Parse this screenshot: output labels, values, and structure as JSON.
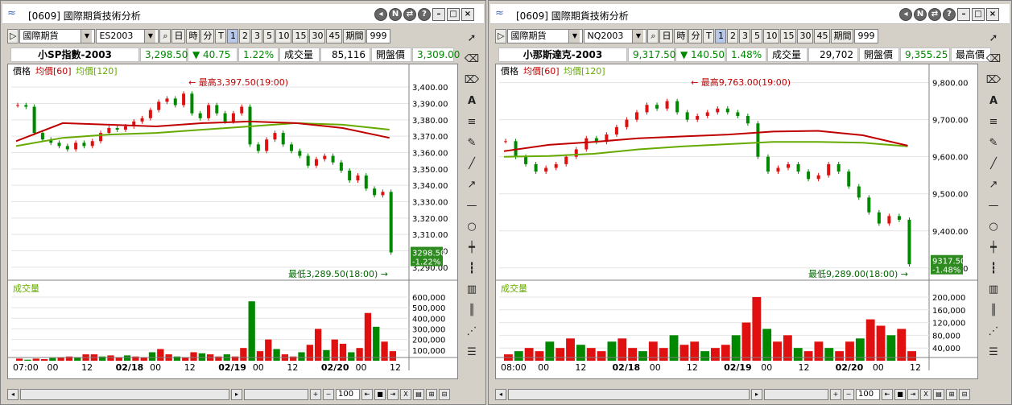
{
  "panels": [
    {
      "title": "[0609] 國際期貨技術分析",
      "market": "國際期貨",
      "code": "ES2003",
      "period_label": "期間",
      "period_value": "999",
      "name": "小SP指數-2003",
      "last": "3,298.50",
      "change": "40.75",
      "pct": "1.22%",
      "vol_label": "成交量",
      "vol": "85,116",
      "open_label": "開盤價",
      "open": "3,309.00",
      "legend_price": "價格",
      "legend_ma60": "均價[60]",
      "legend_ma120": "均價[120]",
      "high_note": "最高3,397.50(19:00)",
      "low_note": "最低3,289.50(18:00)",
      "tag_price": "3298.50",
      "tag_pct": "-1.22%",
      "vol_title": "成交量",
      "zoom": "100",
      "y_ticks": [
        "3,400.00",
        "3,390.00",
        "3,380.00",
        "3,370.00",
        "3,360.00",
        "3,350.00",
        "3,340.00",
        "3,330.00",
        "3,320.00",
        "3,310.00",
        "3,300.00",
        "3,290.00"
      ],
      "vol_ticks": [
        "600,000",
        "500,000",
        "400,000",
        "300,000",
        "200,000",
        "100,000"
      ],
      "x_labels": [
        "07:00",
        "00",
        "12",
        "02/18",
        "00",
        "12",
        "02/19",
        "00",
        "12",
        "02/20",
        "00",
        "12"
      ]
    },
    {
      "title": "[0609] 國際期貨技術分析",
      "market": "國際期貨",
      "code": "NQ2003",
      "period_label": "期間",
      "period_value": "999",
      "name": "小那斯達克-2003",
      "last": "9,317.50",
      "change": "140.50",
      "pct": "1.48%",
      "vol_label": "成交量",
      "vol": "29,702",
      "open_label": "開盤價",
      "open": "9,355.25",
      "high_label": "最高價",
      "legend_price": "價格",
      "legend_ma60": "均價[60]",
      "legend_ma120": "均價[120]",
      "high_note": "最高9,763.00(19:00)",
      "low_note": "最低9,289.00(18:00)",
      "tag_price": "9317.50",
      "tag_pct": "-1.48%",
      "vol_title": "成交量",
      "zoom": "100",
      "y_ticks": [
        "9,800.00",
        "9,700.00",
        "9,600.00",
        "9,500.00",
        "9,400.00",
        "9,300.00"
      ],
      "vol_ticks": [
        "200,000",
        "160,000",
        "120,000",
        "80,000",
        "40,000"
      ],
      "x_labels": [
        "08:00",
        "00",
        "12",
        "02/18",
        "00",
        "12",
        "02/19",
        "00",
        "12",
        "02/20",
        "00",
        "12"
      ]
    }
  ],
  "timeframes": [
    "日",
    "時",
    "分",
    "T",
    "1",
    "2",
    "3",
    "5",
    "10",
    "15",
    "30",
    "45"
  ],
  "colors": {
    "up": "#e01010",
    "down": "#008800",
    "ma60": "#c00000",
    "ma120": "#66aa00",
    "legend": "#c00000",
    "tag": "#2e8b20",
    "grid": "#e4e4e4"
  },
  "chart_data": [
    {
      "type": "candlestick",
      "title": "小SP指數-2003",
      "ylim": [
        3285,
        3405
      ],
      "y_values_approx": [
        3389,
        3388,
        3372,
        3368,
        3366,
        3364,
        3362,
        3366,
        3364,
        3367,
        3372,
        3375,
        3374,
        3376,
        3379,
        3381,
        3386,
        3391,
        3393,
        3389,
        3396,
        3384,
        3381,
        3389,
        3384,
        3379,
        3384,
        3388,
        3365,
        3361,
        3368,
        3372,
        3365,
        3361,
        3358,
        3352,
        3356,
        3358,
        3354,
        3349,
        3343,
        3346,
        3338,
        3334,
        3336,
        3299
      ],
      "ma60_approx": [
        3367,
        3378,
        3377,
        3376,
        3378,
        3379,
        3378,
        3375,
        3369
      ],
      "ma120_approx": [
        3364,
        3369,
        3371,
        3372,
        3374,
        3376,
        3378,
        3377,
        3374
      ],
      "volume_approx": [
        20000,
        10000,
        20000,
        15000,
        25000,
        30000,
        40000,
        30000,
        60000,
        60000,
        40000,
        50000,
        30000,
        50000,
        40000,
        30000,
        80000,
        110000,
        60000,
        40000,
        30000,
        80000,
        70000,
        60000,
        40000,
        60000,
        40000,
        120000,
        560000,
        90000,
        200000,
        110000,
        60000,
        40000,
        80000,
        150000,
        300000,
        100000,
        200000,
        160000,
        80000,
        120000,
        450000,
        320000,
        180000,
        90000
      ]
    },
    {
      "type": "candlestick",
      "title": "小那斯達克-2003",
      "ylim": [
        9280,
        9810
      ],
      "y_values_approx": [
        9642,
        9600,
        9580,
        9560,
        9570,
        9580,
        9600,
        9620,
        9650,
        9640,
        9660,
        9680,
        9700,
        9720,
        9740,
        9730,
        9750,
        9720,
        9700,
        9710,
        9720,
        9730,
        9720,
        9710,
        9690,
        9600,
        9560,
        9570,
        9580,
        9560,
        9540,
        9550,
        9580,
        9560,
        9520,
        9490,
        9450,
        9420,
        9440,
        9430,
        9310
      ],
      "ma60_approx": [
        9615,
        9632,
        9640,
        9650,
        9655,
        9660,
        9668,
        9670,
        9658,
        9630
      ],
      "ma120_approx": [
        9600,
        9602,
        9608,
        9620,
        9628,
        9634,
        9640,
        9640,
        9638,
        9628
      ],
      "volume_approx": [
        20000,
        30000,
        40000,
        30000,
        60000,
        40000,
        70000,
        50000,
        40000,
        30000,
        60000,
        70000,
        40000,
        30000,
        60000,
        40000,
        80000,
        50000,
        60000,
        30000,
        40000,
        50000,
        80000,
        120000,
        200000,
        100000,
        60000,
        80000,
        40000,
        30000,
        60000,
        40000,
        30000,
        60000,
        70000,
        130000,
        110000,
        80000,
        100000,
        30000
      ]
    }
  ]
}
